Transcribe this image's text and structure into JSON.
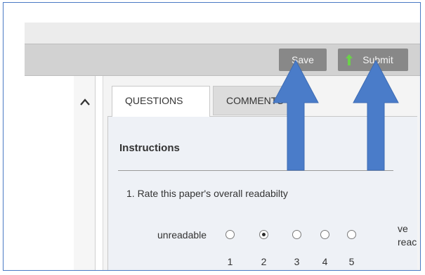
{
  "toolbar": {
    "save_label": "Save",
    "submit_label": "Submit"
  },
  "tabs": [
    {
      "label": "QUESTIONS",
      "active": true
    },
    {
      "label": "COMMENTS",
      "active": false
    }
  ],
  "panel": {
    "instructions_heading": "Instructions",
    "question": {
      "number": "1.",
      "text": "Rate this paper's overall readabilty",
      "text_full": "1.  Rate this paper's overall readabilty",
      "scale_left_label": "unreadable",
      "scale_right_label_line1": "ve",
      "scale_right_label_line2": "reac",
      "options": [
        "1",
        "2",
        "3",
        "4",
        "5"
      ],
      "selected": "2"
    }
  },
  "annotations": {
    "arrow_color": "#4a7cc9",
    "arrow_count": 2
  },
  "colors": {
    "toolbar_button_bg": "#888888",
    "submit_icon": "#6bd14a",
    "frame_border": "#4a7ac4"
  }
}
